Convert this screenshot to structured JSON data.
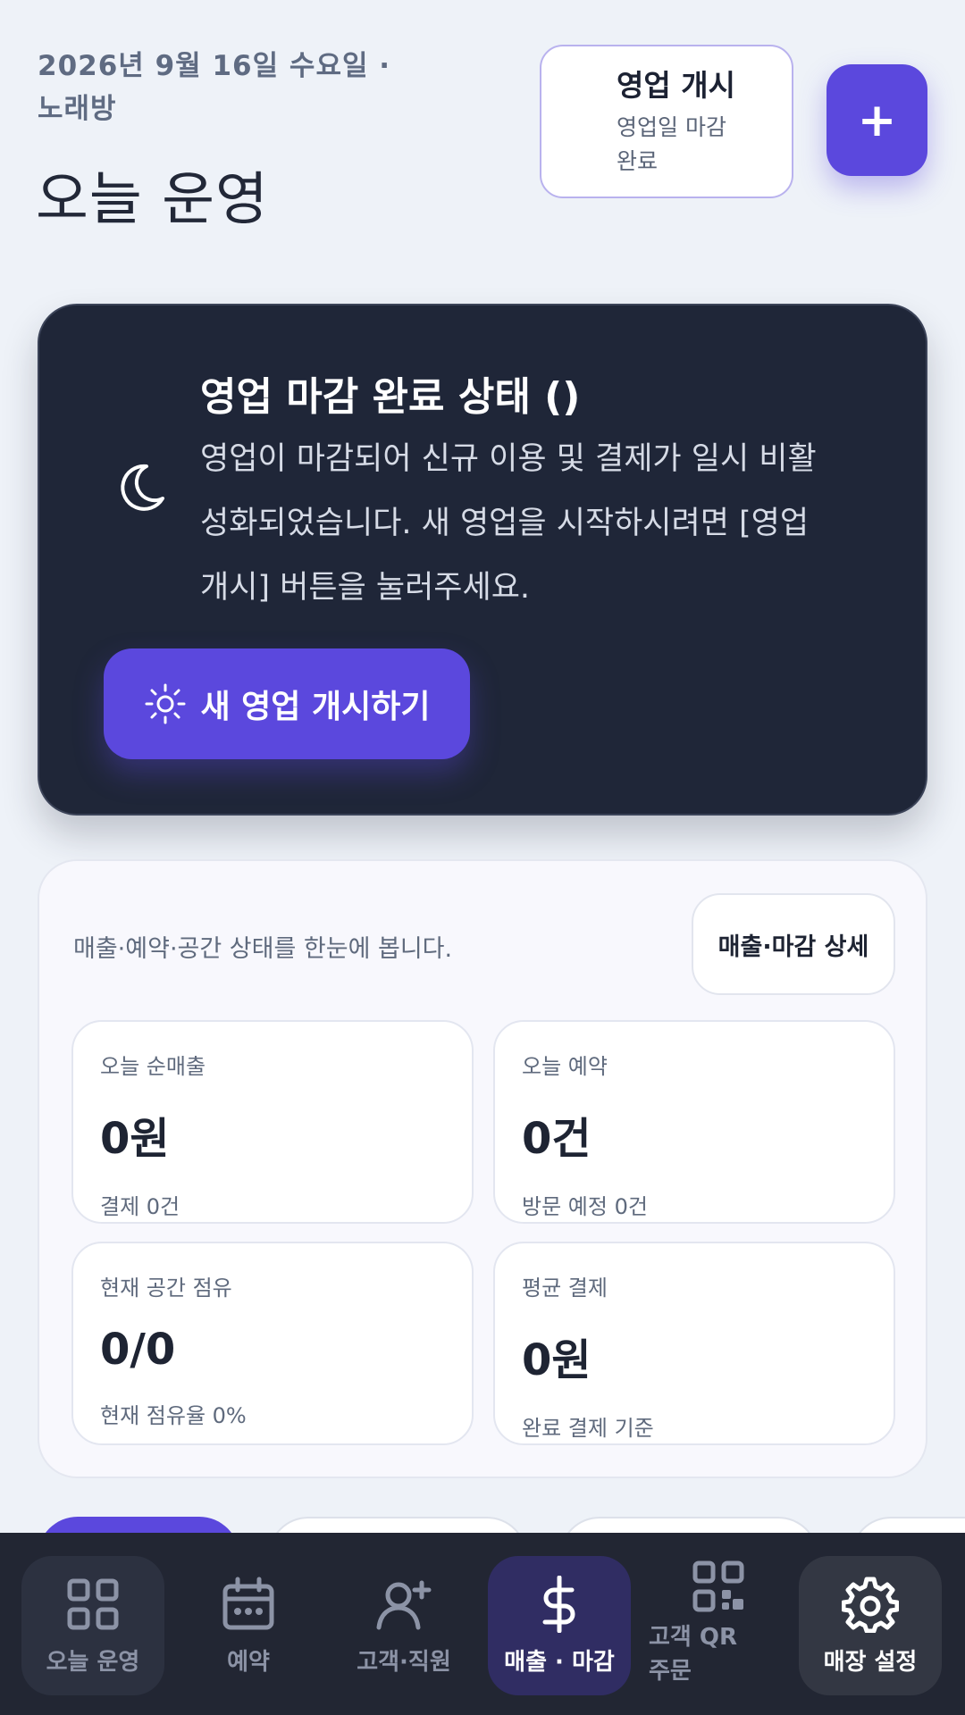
{
  "header": {
    "date_line": "2026년 9월 16일 수요일 · 노래방",
    "title": "오늘 운영",
    "open_card_title": "영업 개시",
    "open_card_sub": "영업일 마감 완료",
    "fab_symbol": "+"
  },
  "banner": {
    "title": "영업 마감 완료 상태 ()",
    "description": "영업이 마감되어 신규 이용 및 결제가 일시 비활성화되었습니다. 새 영업을 시작하시려면 [영업 개시] 버튼을 눌러주세요.",
    "start_button": "새 영업 개시하기"
  },
  "summary": {
    "description": "매출·예약·공간 상태를 한눈에 봅니다.",
    "detail_button": "매출·마감 상세",
    "stats": [
      {
        "label": "오늘 순매출",
        "value": "0원",
        "sub": "결제 0건"
      },
      {
        "label": "오늘 예약",
        "value": "0건",
        "sub": "방문 예정 0건"
      },
      {
        "label": "현재 공간 점유",
        "value": "0/0",
        "sub": "현재 점유율 0%"
      },
      {
        "label": "평균 결제",
        "value": "0원",
        "sub": "완료 결제 기준"
      }
    ]
  },
  "nav": {
    "items": [
      {
        "label": "오늘 운영",
        "icon": "grid-icon"
      },
      {
        "label": "예약",
        "icon": "calendar-icon"
      },
      {
        "label": "고객·직원",
        "icon": "user-plus-icon"
      },
      {
        "label": "매출 · 마감",
        "icon": "dollar-icon",
        "active": true
      },
      {
        "label": "고객 QR 주문",
        "icon": "qr-icon"
      },
      {
        "label": "매장 설정",
        "icon": "gear-icon"
      }
    ]
  },
  "colors": {
    "accent": "#5b48dd",
    "banner_bg": "#1f2638",
    "nav_bg": "#222633",
    "page_bg": "#eef2f8"
  }
}
